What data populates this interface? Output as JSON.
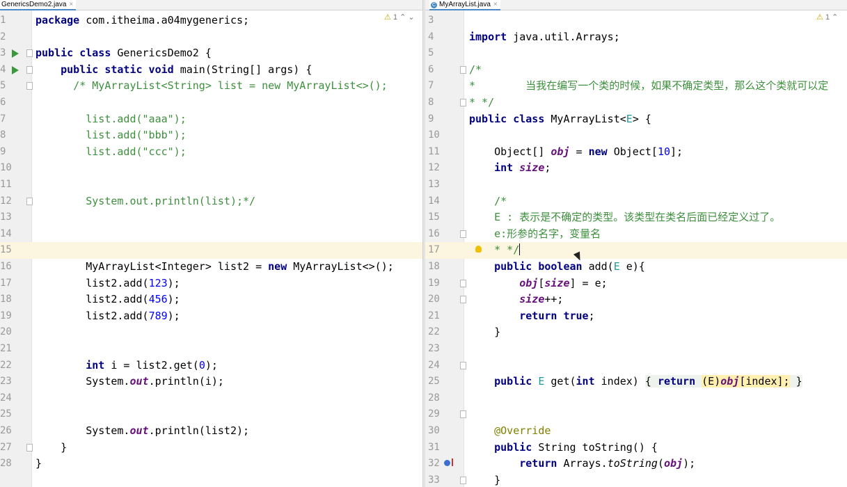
{
  "left": {
    "tab": {
      "title": "GenericsDemo2.java",
      "close": "×"
    },
    "hint": {
      "warn_icon": "⚠",
      "count": "1"
    },
    "lines": [
      {
        "n": "1",
        "tokens": [
          {
            "t": "package ",
            "c": "k"
          },
          {
            "t": "com.itheima.a04mygenerics;"
          }
        ]
      },
      {
        "n": "2",
        "tokens": []
      },
      {
        "n": "3",
        "tokens": [
          {
            "t": "public class ",
            "c": "k"
          },
          {
            "t": "GenericsDemo2 {"
          }
        ]
      },
      {
        "n": "4",
        "tokens": [
          {
            "t": "    public static void ",
            "c": "k"
          },
          {
            "t": "main(String[] args) {"
          }
        ]
      },
      {
        "n": "5",
        "tokens": [
          {
            "t": "      "
          },
          {
            "t": "/* MyArrayList<String> list = new MyArrayList<>();",
            "c": "cg"
          }
        ]
      },
      {
        "n": "6",
        "tokens": []
      },
      {
        "n": "7",
        "tokens": [
          {
            "t": "        list.add(\"aaa\");",
            "c": "cg"
          }
        ]
      },
      {
        "n": "8",
        "tokens": [
          {
            "t": "        list.add(\"bbb\");",
            "c": "cg"
          }
        ]
      },
      {
        "n": "9",
        "tokens": [
          {
            "t": "        list.add(\"ccc\");",
            "c": "cg"
          }
        ]
      },
      {
        "n": "10",
        "tokens": []
      },
      {
        "n": "11",
        "tokens": []
      },
      {
        "n": "12",
        "tokens": [
          {
            "t": "        System.out.println(list);*/",
            "c": "cg"
          }
        ]
      },
      {
        "n": "13",
        "tokens": []
      },
      {
        "n": "14",
        "tokens": []
      },
      {
        "n": "15",
        "tokens": []
      },
      {
        "n": "16",
        "tokens": [
          {
            "t": "        MyArrayList<Integer> list2 = "
          },
          {
            "t": "new ",
            "c": "k"
          },
          {
            "t": "MyArrayList<>();"
          }
        ]
      },
      {
        "n": "17",
        "tokens": [
          {
            "t": "        list2.add("
          },
          {
            "t": "123",
            "c": "n"
          },
          {
            "t": ");"
          }
        ]
      },
      {
        "n": "18",
        "tokens": [
          {
            "t": "        list2.add("
          },
          {
            "t": "456",
            "c": "n"
          },
          {
            "t": ");"
          }
        ]
      },
      {
        "n": "19",
        "tokens": [
          {
            "t": "        list2.add("
          },
          {
            "t": "789",
            "c": "n"
          },
          {
            "t": ");"
          }
        ]
      },
      {
        "n": "20",
        "tokens": []
      },
      {
        "n": "21",
        "tokens": []
      },
      {
        "n": "22",
        "tokens": [
          {
            "t": "        "
          },
          {
            "t": "int ",
            "c": "k"
          },
          {
            "t": "i = list2.get("
          },
          {
            "t": "0",
            "c": "n"
          },
          {
            "t": ");"
          }
        ]
      },
      {
        "n": "23",
        "tokens": [
          {
            "t": "        System."
          },
          {
            "t": "out",
            "c": "f"
          },
          {
            "t": ".println(i);"
          }
        ]
      },
      {
        "n": "24",
        "tokens": []
      },
      {
        "n": "25",
        "tokens": []
      },
      {
        "n": "26",
        "tokens": [
          {
            "t": "        System."
          },
          {
            "t": "out",
            "c": "f"
          },
          {
            "t": ".println(list2);"
          }
        ]
      },
      {
        "n": "27",
        "tokens": [
          {
            "t": "    }"
          }
        ]
      },
      {
        "n": "28",
        "tokens": [
          {
            "t": "}"
          }
        ]
      }
    ]
  },
  "right": {
    "tab": {
      "title": "MyArrayList.java",
      "close": "×",
      "file_icon": "C"
    },
    "hint": {
      "warn_icon": "⚠",
      "count": "1"
    },
    "lines": [
      {
        "n": "3",
        "tokens": []
      },
      {
        "n": "4",
        "tokens": [
          {
            "t": "import ",
            "c": "k"
          },
          {
            "t": "java.util.Arrays;"
          }
        ]
      },
      {
        "n": "5",
        "tokens": []
      },
      {
        "n": "6",
        "tokens": [
          {
            "t": "/*",
            "c": "cg"
          }
        ]
      },
      {
        "n": "7",
        "tokens": [
          {
            "t": "*        当我在编写一个类的时候，如果不确定类型，那么这个类就可以定",
            "c": "cg"
          }
        ]
      },
      {
        "n": "8",
        "tokens": [
          {
            "t": "* */",
            "c": "cg"
          }
        ]
      },
      {
        "n": "9",
        "tokens": [
          {
            "t": "public class ",
            "c": "k"
          },
          {
            "t": "MyArrayList<"
          },
          {
            "t": "E",
            "c": "tp"
          },
          {
            "t": "> {"
          }
        ]
      },
      {
        "n": "10",
        "tokens": []
      },
      {
        "n": "11",
        "tokens": [
          {
            "t": "    Object[] "
          },
          {
            "t": "obj",
            "c": "f2"
          },
          {
            "t": " = "
          },
          {
            "t": "new ",
            "c": "k"
          },
          {
            "t": "Object["
          },
          {
            "t": "10",
            "c": "n"
          },
          {
            "t": "];"
          }
        ]
      },
      {
        "n": "12",
        "tokens": [
          {
            "t": "    "
          },
          {
            "t": "int ",
            "c": "k"
          },
          {
            "t": "size",
            "c": "f2"
          },
          {
            "t": ";"
          }
        ]
      },
      {
        "n": "13",
        "tokens": []
      },
      {
        "n": "14",
        "tokens": [
          {
            "t": "    /*",
            "c": "cg"
          }
        ]
      },
      {
        "n": "15",
        "tokens": [
          {
            "t": "    E : 表示是不确定的类型。该类型在类名后面已经定义过了。",
            "c": "cg"
          }
        ]
      },
      {
        "n": "16",
        "tokens": [
          {
            "t": "    e:形参的名字，变量名",
            "c": "cg"
          }
        ]
      },
      {
        "n": "17",
        "tokens": [
          {
            "t": "    * */",
            "c": "cg"
          }
        ]
      },
      {
        "n": "18",
        "tokens": [
          {
            "t": "    public boolean ",
            "c": "k"
          },
          {
            "t": "add("
          },
          {
            "t": "E",
            "c": "tp"
          },
          {
            "t": " e){"
          }
        ]
      },
      {
        "n": "19",
        "tokens": [
          {
            "t": "        "
          },
          {
            "t": "obj",
            "c": "f2"
          },
          {
            "t": "["
          },
          {
            "t": "size",
            "c": "f2"
          },
          {
            "t": "] = e;"
          }
        ]
      },
      {
        "n": "20",
        "tokens": [
          {
            "t": "        "
          },
          {
            "t": "size",
            "c": "f2"
          },
          {
            "t": "++;"
          }
        ]
      },
      {
        "n": "21",
        "tokens": [
          {
            "t": "        "
          },
          {
            "t": "return true",
            "c": "k"
          },
          {
            "t": ";"
          }
        ]
      },
      {
        "n": "22",
        "tokens": [
          {
            "t": "    }"
          }
        ]
      },
      {
        "n": "23",
        "tokens": []
      },
      {
        "n": "24",
        "tokens": []
      },
      {
        "n": "25",
        "tokens": [
          {
            "t": "    "
          },
          {
            "t": "public ",
            "c": "k"
          },
          {
            "t": "E",
            "c": "tp"
          },
          {
            "t": " get("
          },
          {
            "t": "int ",
            "c": "k"
          },
          {
            "t": "index) "
          },
          {
            "t": "{ ",
            "c": "fb"
          },
          {
            "t": "return ",
            "c": "kfb"
          },
          {
            "t": "(E)",
            "c": "ph"
          },
          {
            "t": "obj",
            "c": "f2ph"
          },
          {
            "t": "[index];",
            "c": "ph"
          },
          {
            "t": " }",
            "c": "fb"
          }
        ]
      },
      {
        "n": "28",
        "tokens": []
      },
      {
        "n": "29",
        "tokens": []
      },
      {
        "n": "30",
        "tokens": [
          {
            "t": "    "
          },
          {
            "t": "@Override",
            "c": "a"
          }
        ]
      },
      {
        "n": "31",
        "tokens": [
          {
            "t": "    "
          },
          {
            "t": "public ",
            "c": "k"
          },
          {
            "t": "String toString() {"
          }
        ]
      },
      {
        "n": "32",
        "tokens": [
          {
            "t": "        "
          },
          {
            "t": "return ",
            "c": "k"
          },
          {
            "t": "Arrays."
          },
          {
            "t": "toString",
            "c": "it"
          },
          {
            "t": "("
          },
          {
            "t": "obj",
            "c": "f2"
          },
          {
            "t": ");"
          }
        ]
      },
      {
        "n": "33",
        "tokens": [
          {
            "t": "    }"
          }
        ]
      }
    ]
  }
}
